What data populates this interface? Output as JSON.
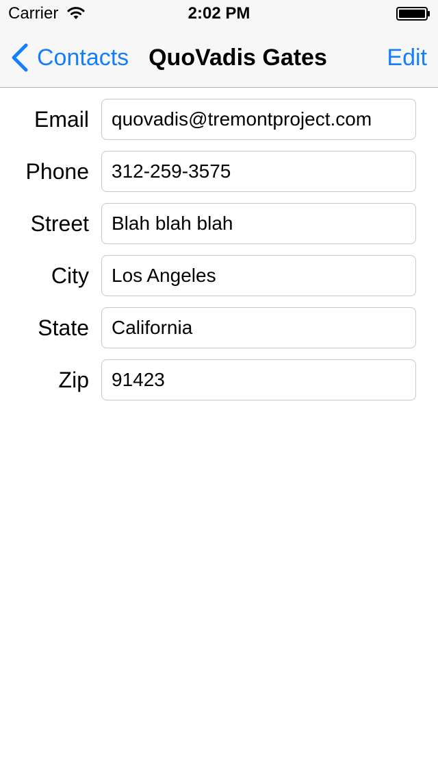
{
  "status_bar": {
    "carrier": "Carrier",
    "time": "2:02 PM",
    "icons": [
      "wifi-icon",
      "battery-icon"
    ]
  },
  "nav_bar": {
    "back_label": "Contacts",
    "title": "QuoVadis Gates",
    "edit_label": "Edit",
    "accent_color": "#157efb",
    "icons": [
      "chevron-left-icon"
    ]
  },
  "form": {
    "fields": [
      {
        "label": "Email",
        "value": "quovadis@tremontproject.com"
      },
      {
        "label": "Phone",
        "value": "312-259-3575"
      },
      {
        "label": "Street",
        "value": "Blah blah blah"
      },
      {
        "label": "City",
        "value": "Los Angeles"
      },
      {
        "label": "State",
        "value": "California"
      },
      {
        "label": "Zip",
        "value": "91423"
      }
    ]
  }
}
